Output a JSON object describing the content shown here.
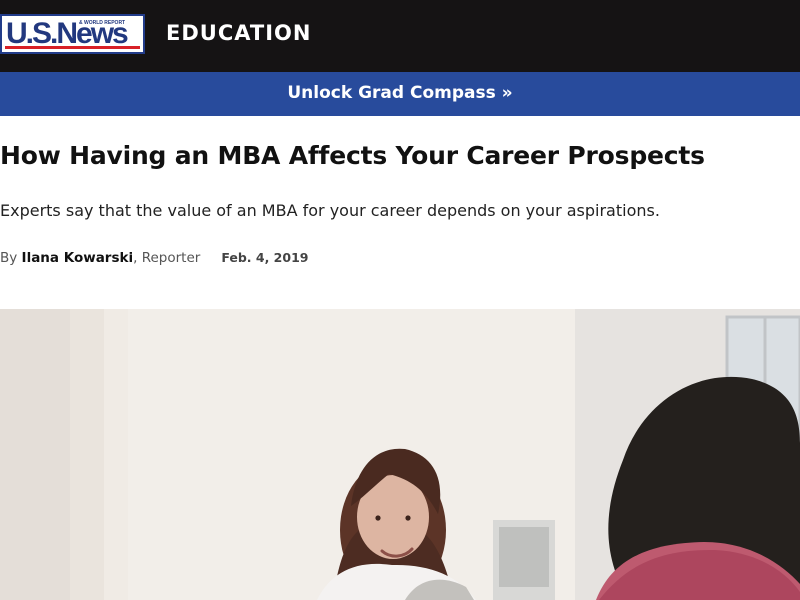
{
  "header": {
    "logo_text": "U.S.News",
    "logo_subtext": "& WORLD REPORT",
    "section_label": "EDUCATION"
  },
  "promo": {
    "label": "Unlock Grad Compass »"
  },
  "article": {
    "headline": "How Having an MBA Affects Your Career Prospects",
    "dek": "Experts say that the value of an MBA for your career depends on your aspirations.",
    "byline_prefix": "By ",
    "author": "Ilana Kowarski",
    "role": ", Reporter",
    "date": "Feb. 4, 2019"
  },
  "colors": {
    "top_bar": "#151314",
    "promo_bar": "#284b9c",
    "logo_blue": "#22387f",
    "logo_red": "#d82027"
  },
  "hero_image": {
    "semantic": "interview-photo"
  }
}
